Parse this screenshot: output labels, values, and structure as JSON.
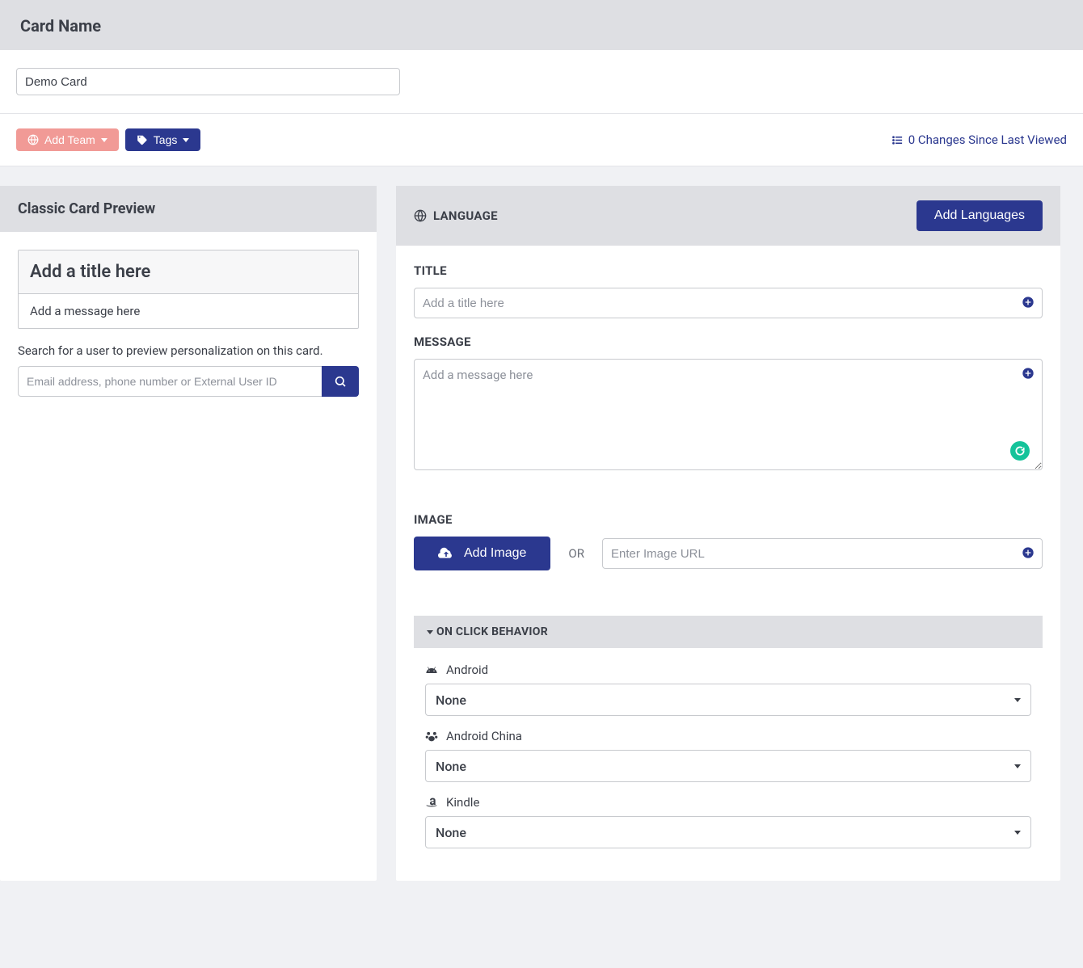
{
  "header": {
    "title": "Card Name"
  },
  "card_name": {
    "value": "Demo Card"
  },
  "toolbar": {
    "add_team": "Add Team",
    "tags": "Tags",
    "changes_text": "0 Changes Since Last Viewed"
  },
  "preview": {
    "panel_title": "Classic Card Preview",
    "title_placeholder": "Add a title here",
    "message_placeholder": "Add a message here",
    "search_label": "Search for a user to preview personalization on this card.",
    "search_placeholder": "Email address, phone number or External User ID"
  },
  "editor": {
    "language_label": "LANGUAGE",
    "add_languages": "Add Languages",
    "title_label": "TITLE",
    "title_placeholder": "Add a title here",
    "message_label": "MESSAGE",
    "message_placeholder": "Add a message here",
    "image_label": "IMAGE",
    "add_image": "Add Image",
    "or_text": "OR",
    "image_url_placeholder": "Enter Image URL"
  },
  "click": {
    "section_label": "ON CLICK BEHAVIOR",
    "platforms": [
      {
        "name": "Android",
        "value": "None"
      },
      {
        "name": "Android China",
        "value": "None"
      },
      {
        "name": "Kindle",
        "value": "None"
      }
    ]
  }
}
